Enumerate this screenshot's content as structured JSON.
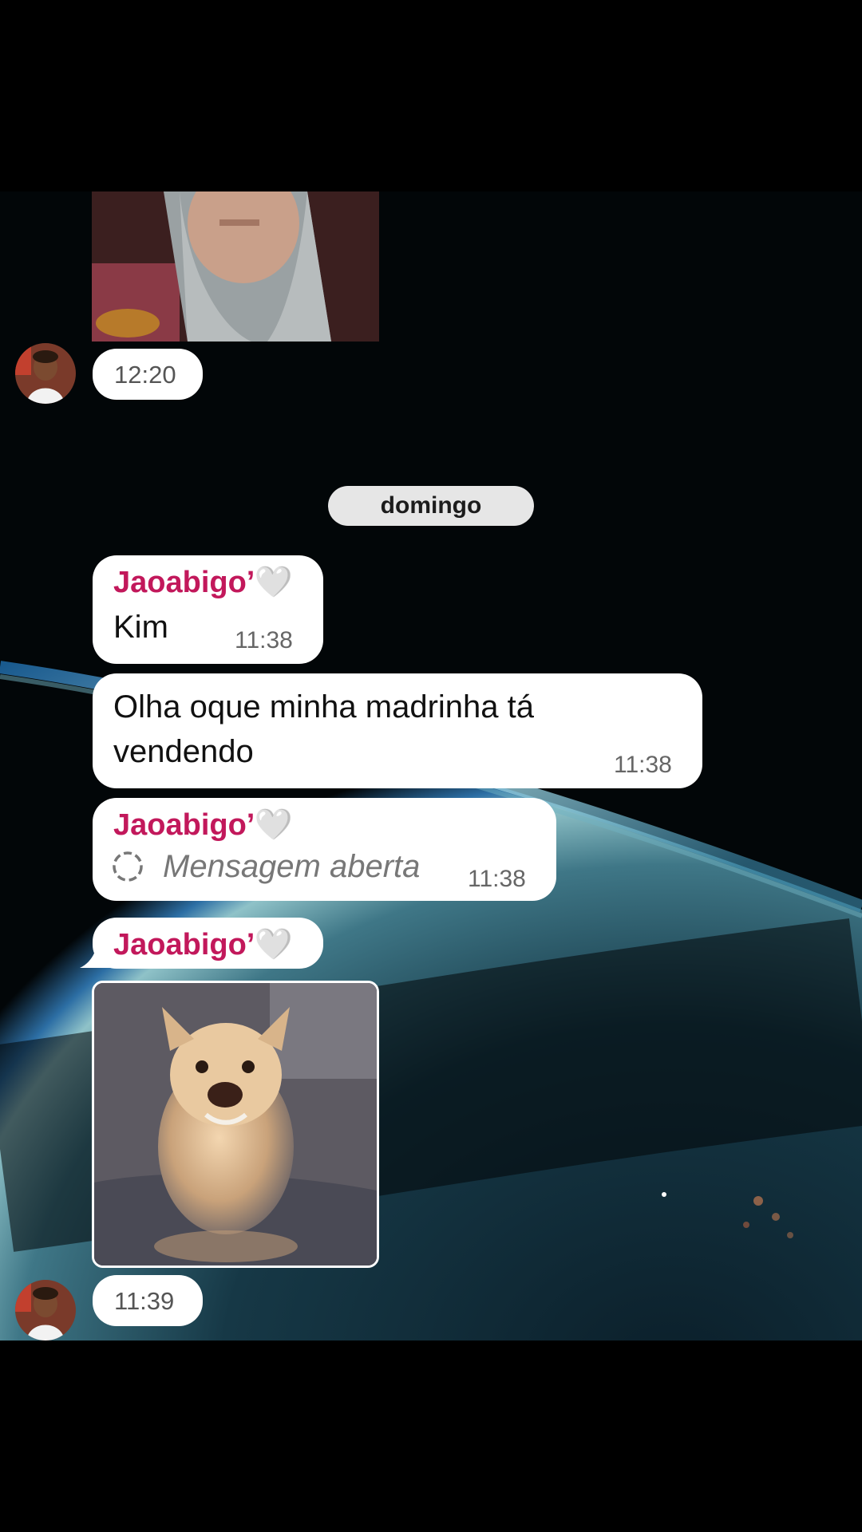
{
  "chat": {
    "day_separator": "domingo",
    "messages": [
      {
        "type": "photo",
        "time": "12:20"
      },
      {
        "sender": "Jaoabigo’",
        "sender_heart": "🤍",
        "text": "Kim",
        "time": "11:38"
      },
      {
        "text_line1": "Olha oque minha madrinha tá",
        "text_line2": "vendendo",
        "time": "11:38"
      },
      {
        "sender": "Jaoabigo’",
        "sender_heart": "🤍",
        "status": "Mensagem aberta",
        "time": "11:38"
      },
      {
        "sender": "Jaoabigo’",
        "sender_heart": "🤍",
        "type": "photo",
        "time": "11:39"
      }
    ]
  }
}
